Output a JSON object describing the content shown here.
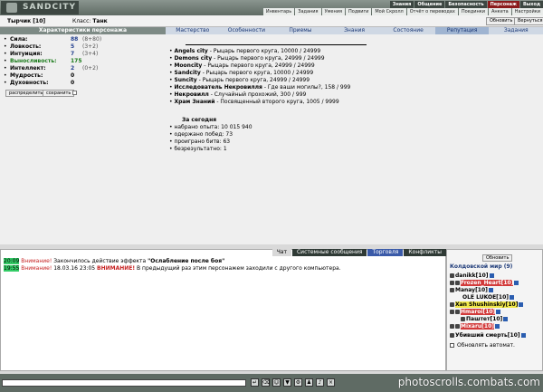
{
  "app": {
    "logo": "SANDCITY"
  },
  "nav_top": [
    "Знания",
    "Общение",
    "Безопасность",
    "Персонаж",
    "Выход"
  ],
  "nav_sub": [
    "Инвентарь",
    "Задания",
    "Умения",
    "Подвиги",
    "Мой Скролл",
    "Отчёт о переводах",
    "Поединки",
    "Анкета",
    "Настройки"
  ],
  "header": {
    "name": "Тырчик [10]",
    "class_label": "Класс:",
    "class_value": "Танк",
    "refresh": "Обновить",
    "return": "Вернуться"
  },
  "stats": {
    "title": "Характеристики персонажа",
    "items": [
      {
        "name": "Сила:",
        "value": "88",
        "bonus": "(8+80)"
      },
      {
        "name": "Ловкость:",
        "value": "5",
        "bonus": "(3+2)"
      },
      {
        "name": "Интуиция:",
        "value": "7",
        "bonus": "(3+4)"
      },
      {
        "name": "Выносливость:",
        "value": "175",
        "bonus": ""
      },
      {
        "name": "Интеллект:",
        "value": "2",
        "bonus": "(0+2)"
      },
      {
        "name": "Мудрость:",
        "value": "0",
        "bonus": ""
      },
      {
        "name": "Духовность:",
        "value": "0",
        "bonus": ""
      }
    ],
    "distribute": "распределить",
    "save": "сохранить"
  },
  "tabs": [
    "Мастерство",
    "Особенности",
    "Приемы",
    "Знания",
    "Состояние",
    "Репутация",
    "Задания"
  ],
  "reputation": [
    {
      "city": "Angels city",
      "text": " - Рыцарь первого круга, 10000 / 24999"
    },
    {
      "city": "Demons city",
      "text": " - Рыцарь первого круга, 24999 / 24999"
    },
    {
      "city": "Mooncity",
      "text": " - Рыцарь первого круга, 24999 / 24999"
    },
    {
      "city": "Sandcity",
      "text": " - Рыцарь первого круга, 10000 / 24999"
    },
    {
      "city": "Suncity",
      "text": " - Рыцарь первого круга, 24999 / 24999"
    },
    {
      "city": "Исследователь Некровилля",
      "text": " - Где ваши могилы?, 158 / 999"
    },
    {
      "city": "Некровилл",
      "text": " - Случайный прохожий, 300 / 999"
    },
    {
      "city": "Храм Знаний",
      "text": " - Посвященный второго круга, 1005 / 9999"
    }
  ],
  "today": {
    "title": "За сегодня",
    "lines": [
      "набрано опыта: 10 015 940",
      "одержано побед: 73",
      "проиграно битв: 63",
      "безрезультатно: 1"
    ]
  },
  "chat_tabs": [
    "Чат",
    "Системные сообщения",
    "Торговля",
    "Конфликты"
  ],
  "chat": {
    "line1": {
      "time": "20:09",
      "warn": "Внимание!",
      "text": " Закончилось действие эффекта ",
      "effect": "\"Ослабление после боя\""
    },
    "line2": {
      "time": "19:55",
      "warn": "Внимание!",
      "date": " 18.03.16 23:05 ",
      "warn2": "ВНИМАНИЕ!",
      "text": " В предыдущий раз этим персонажем заходили с другого компьютера."
    }
  },
  "side": {
    "refresh": "Обновить",
    "title": "Колдовской мир (9)",
    "players": [
      "danikk[10]",
      "Frozen_Heart[10]",
      "Manay[10]",
      "OLE LUKOE[10]",
      "Xan Shushinskiy[10]",
      "Hmaroi[10]",
      "Паштет[10]",
      "Mixaru[10]",
      "Убивший смерть[10]"
    ],
    "auto": "Обновлять автомат."
  },
  "watermark": "photoscrolls.combats.com"
}
